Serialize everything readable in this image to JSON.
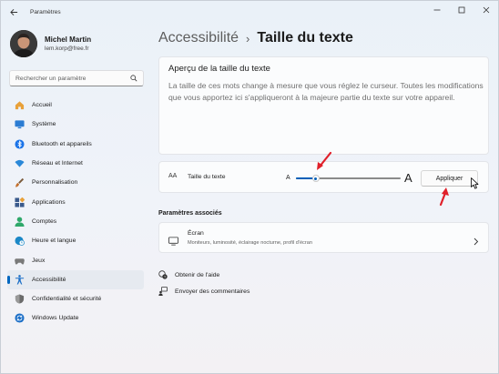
{
  "window": {
    "title": "Paramètres",
    "controls": [
      "minimize-icon",
      "maximize-icon",
      "close-icon"
    ]
  },
  "profile": {
    "name": "Michel Martin",
    "email": "lem.korp@free.fr"
  },
  "search": {
    "placeholder": "Rechercher un paramètre"
  },
  "sidebar": {
    "items": [
      {
        "label": "Accueil",
        "icon": "home-icon",
        "color": "#e8a13a"
      },
      {
        "label": "Système",
        "icon": "system-icon",
        "color": "#2b7cd3"
      },
      {
        "label": "Bluetooth et appareils",
        "icon": "bluetooth-icon",
        "color": "#1a73e8"
      },
      {
        "label": "Réseau et Internet",
        "icon": "wifi-icon",
        "color": "#2b88d8"
      },
      {
        "label": "Personnalisation",
        "icon": "brush-icon",
        "color": "#c4702d"
      },
      {
        "label": "Applications",
        "icon": "apps-icon",
        "color": "#3a5a8c"
      },
      {
        "label": "Comptes",
        "icon": "account-icon",
        "color": "#2fa86a"
      },
      {
        "label": "Heure et langue",
        "icon": "globe-clock-icon",
        "color": "#1c88c7"
      },
      {
        "label": "Jeux",
        "icon": "gamepad-icon",
        "color": "#7a7a7a"
      },
      {
        "label": "Accessibilité",
        "icon": "accessibility-icon",
        "color": "#1c6fc7",
        "active": true
      },
      {
        "label": "Confidentialité et sécurité",
        "icon": "shield-icon",
        "color": "#6b6b6b"
      },
      {
        "label": "Windows Update",
        "icon": "update-icon",
        "color": "#1c6fc7"
      }
    ]
  },
  "breadcrumb": {
    "parent": "Accessibilité",
    "separator": "›",
    "current": "Taille du texte"
  },
  "preview": {
    "title": "Aperçu de la taille du texte",
    "body": "La taille de ces mots change à mesure que vous réglez le curseur. Toutes les modifications que vous apportez ici s'appliqueront à la majeure partie du texte sur votre appareil."
  },
  "text_size": {
    "icon_text": "AA",
    "label": "Taille du texte",
    "small_marker": "A",
    "large_marker": "A",
    "slider_value_fraction": 0.19,
    "apply_label": "Appliquer"
  },
  "related": {
    "title": "Paramètres associés",
    "screen_title": "Écran",
    "screen_subtitle": "Moniteurs, luminosité, éclairage nocturne, profil d'écran"
  },
  "links": {
    "help": "Obtenir de l'aide",
    "feedback": "Envoyer des commentaires"
  },
  "colors": {
    "accent": "#005fb8",
    "annotation_arrow": "#e0202a"
  }
}
